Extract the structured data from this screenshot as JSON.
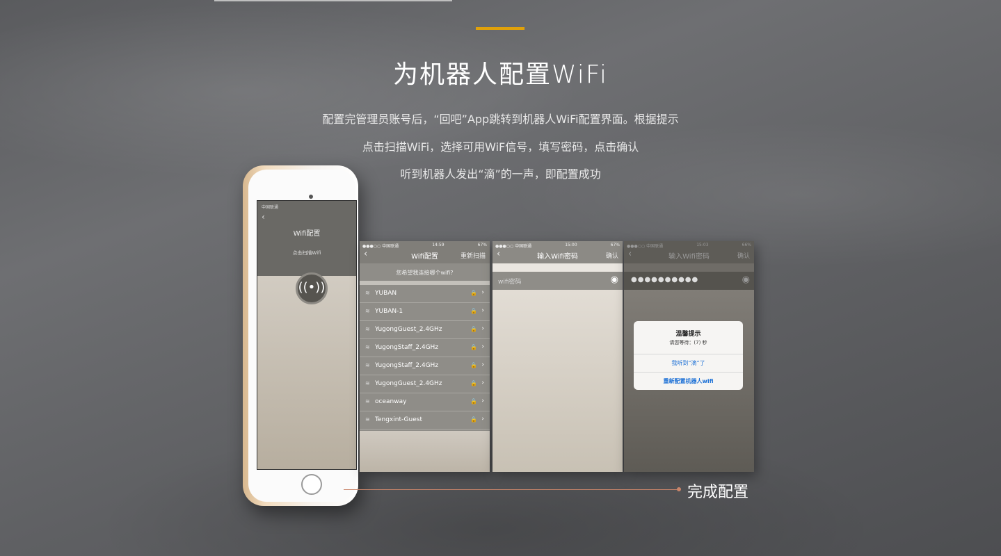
{
  "header": {
    "title": "为机器人配置WiFi",
    "desc_lines": [
      "配置完管理员账号后，“回吧”App跳转到机器人WiFi配置界面。根据提示",
      "点击扫描WiFi，选择可用WiF信号，填写密码，点击确认",
      "听到机器人发出“滴”的一声，即配置成功"
    ],
    "accent_color": "#e0a10a"
  },
  "phone": {
    "status": "中国联通",
    "back": "‹",
    "title": "Wifi配置",
    "hint": "点击扫描Wifi",
    "button_icon": "wifi-icon",
    "button_glyph": "((•))"
  },
  "screen1": {
    "status_left": "●●●○○ 中国联通",
    "status_time": "14:59",
    "status_right": "67%",
    "back": "‹",
    "title": "Wifi配置",
    "right": "重新扫描",
    "question": "您希望我连接哪个wifi?",
    "wifi_glyph": "≋",
    "lock_glyph": "🔒",
    "chevron_glyph": "›",
    "networks": [
      "YUBAN",
      "YUBAN-1",
      "YugongGuest_2.4GHz",
      "YugongStaff_2.4GHz",
      "YugongStaff_2.4GHz",
      "YugongGuest_2.4GHz",
      "oceanway",
      "Tengxint-Guest"
    ]
  },
  "screen2": {
    "status_left": "●●●○○ 中国联通",
    "status_time": "15:00",
    "status_right": "67%",
    "back": "‹",
    "title": "输入Wifi密码",
    "right": "确认",
    "placeholder": "wifi密码",
    "eye_glyph": "◉"
  },
  "screen3": {
    "status_left": "●●●○○ 中国联通",
    "status_time": "15:03",
    "status_right": "66%",
    "back": "‹",
    "title": "输入Wifi密码",
    "right": "确认",
    "password_mask": "●●●●●●●●●●",
    "eye_glyph": "◉",
    "dialog": {
      "title": "温馨提示",
      "message": "请您等待：(7) 秒",
      "button1": "我听到“滴”了",
      "button2": "重新配置机器人wifi"
    }
  },
  "footer": {
    "label": "完成配置"
  }
}
